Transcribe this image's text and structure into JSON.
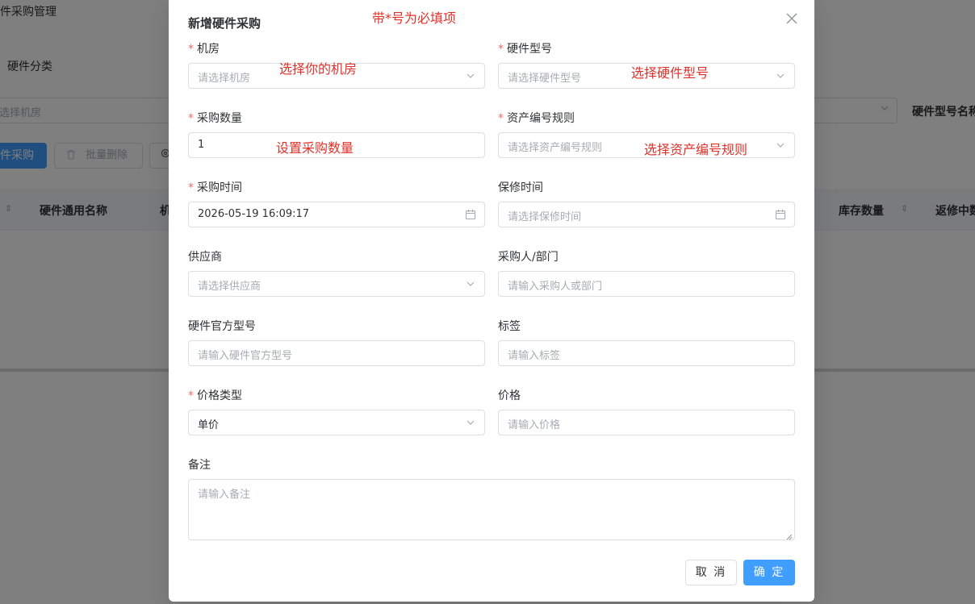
{
  "background": {
    "page_title": "硬件采购管理",
    "category_label": "硬件分类",
    "room_filter_placeholder": "选择机房",
    "model_filter_label": "硬件型号名称",
    "add_button": "件采购",
    "batch_delete_button": "批量删除",
    "table_headers": [
      "硬件通用名称",
      "机",
      "库存数量",
      "返修中数"
    ]
  },
  "dialog": {
    "title": "新增硬件采购",
    "required_hint": "带*号为必填项",
    "fields": {
      "room": {
        "label": "机房",
        "required": true,
        "placeholder": "请选择机房",
        "annotation": "选择你的机房"
      },
      "model": {
        "label": "硬件型号",
        "required": true,
        "placeholder": "请选择硬件型号",
        "annotation": "选择硬件型号"
      },
      "quantity": {
        "label": "采购数量",
        "required": true,
        "value": "1",
        "annotation": "设置采购数量"
      },
      "asset_rule": {
        "label": "资产编号规则",
        "required": true,
        "placeholder": "请选择资产编号规则",
        "annotation": "选择资产编号规则"
      },
      "purchase_time": {
        "label": "采购时间",
        "required": true,
        "value": "2026-05-19 16:09:17"
      },
      "warranty_time": {
        "label": "保修时间",
        "required": false,
        "placeholder": "请选择保修时间"
      },
      "supplier": {
        "label": "供应商",
        "required": false,
        "placeholder": "请选择供应商"
      },
      "purchaser": {
        "label": "采购人/部门",
        "required": false,
        "placeholder": "请输入采购人或部门"
      },
      "official_model": {
        "label": "硬件官方型号",
        "required": false,
        "placeholder": "请输入硬件官方型号"
      },
      "tags": {
        "label": "标签",
        "required": false,
        "placeholder": "请输入标签"
      },
      "price_type": {
        "label": "价格类型",
        "required": true,
        "value": "单价"
      },
      "price": {
        "label": "价格",
        "required": false,
        "placeholder": "请输入价格"
      },
      "remark": {
        "label": "备注",
        "required": false,
        "placeholder": "请输入备注"
      }
    },
    "buttons": {
      "cancel": "取 消",
      "confirm": "确 定"
    }
  },
  "colors": {
    "primary": "#409eff",
    "required_star": "#f56c6c",
    "annotation": "#e0312b"
  }
}
